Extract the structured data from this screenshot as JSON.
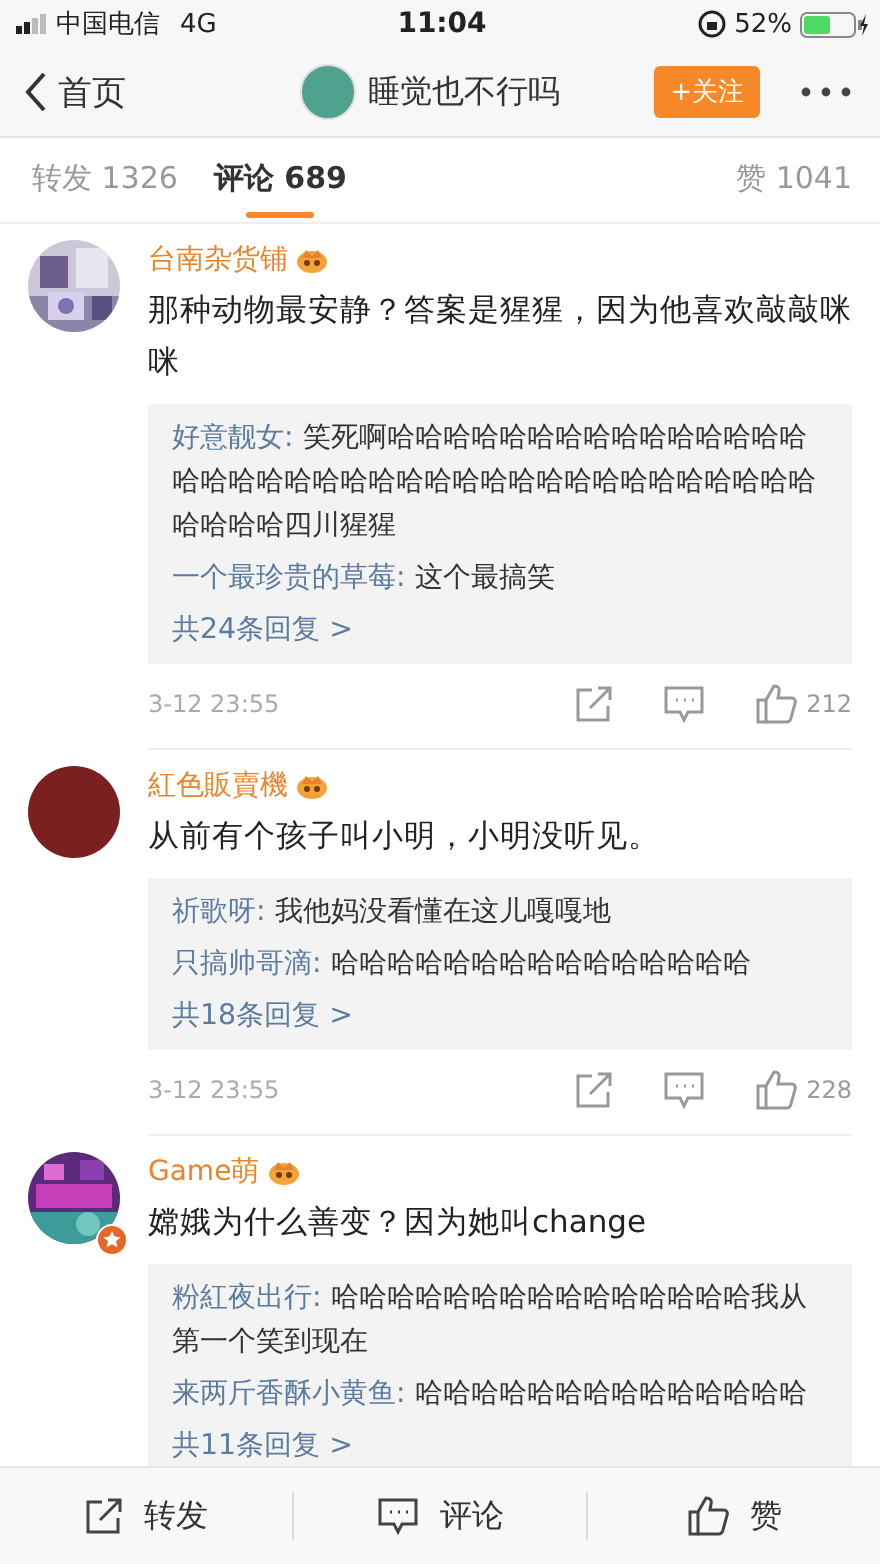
{
  "status_bar": {
    "carrier": "中国电信",
    "network": "4G",
    "time": "11:04",
    "battery": "52%"
  },
  "nav": {
    "back": "首页",
    "title": "睡觉也不行吗",
    "follow": "+关注"
  },
  "tabs": [
    {
      "label": "转发 1326",
      "selected": false
    },
    {
      "label": "评论 689",
      "selected": true
    },
    {
      "label": "赞 1041",
      "selected": false
    }
  ],
  "comments": [
    {
      "author": "台南杂货铺",
      "avatar": {
        "kind": "picture"
      },
      "text": "那种动物最安静？答案是猩猩，因为他喜欢敲敲咪咪",
      "replies": [
        {
          "author": "好意靓女:",
          "text": "笑死啊哈哈哈哈哈哈哈哈哈哈哈哈哈哈哈哈哈哈哈哈哈哈哈哈哈哈哈哈哈哈哈哈哈哈哈哈哈哈哈哈哈哈四川猩猩"
        },
        {
          "author": "一个最珍贵的草莓:",
          "text": "这个最搞笑"
        }
      ],
      "more": "共24条回复 >",
      "time": "3-12 23:55",
      "likes": "212"
    },
    {
      "author": "紅色販賣機",
      "avatar": {
        "kind": "plain"
      },
      "text": "从前有个孩子叫小明，小明没听见。",
      "replies": [
        {
          "author": "祈歌呀:",
          "text": "我他妈没看懂在这儿嘎嘎地"
        },
        {
          "author": "只搞帅哥滴:",
          "text": "哈哈哈哈哈哈哈哈哈哈哈哈哈哈哈"
        }
      ],
      "more": "共18条回复 >",
      "time": "3-12 23:55",
      "likes": "228"
    },
    {
      "author": "Game萌",
      "avatar": {
        "kind": "picture",
        "badge": true
      },
      "text": "嫦娥为什么善变？因为她叫change",
      "replies": [
        {
          "author": "粉紅夜出行:",
          "text": "哈哈哈哈哈哈哈哈哈哈哈哈哈哈哈我从第一个笑到现在"
        },
        {
          "author": "来两斤香酥小黄鱼:",
          "text": "哈哈哈哈哈哈哈哈哈哈哈哈哈哈"
        }
      ],
      "more": "共11条回复 >"
    }
  ],
  "bottom_bar": {
    "actions": [
      {
        "kind": "repost",
        "label": "转发"
      },
      {
        "kind": "comment",
        "label": "评论"
      },
      {
        "kind": "like",
        "label": "赞"
      }
    ]
  }
}
